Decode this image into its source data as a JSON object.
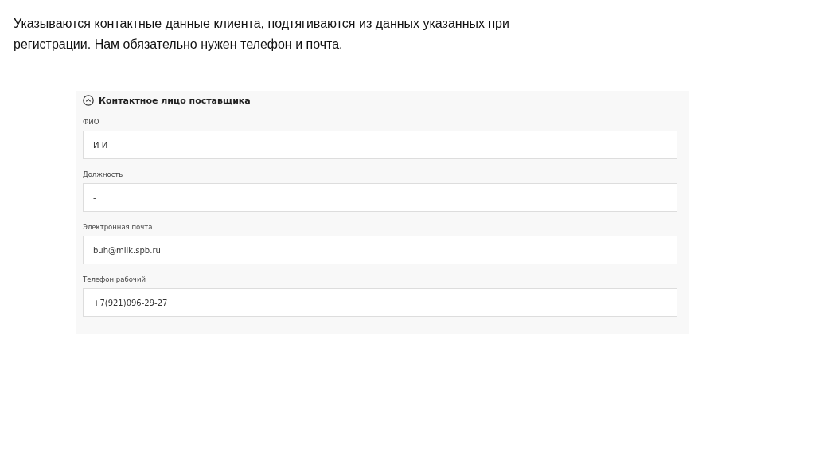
{
  "caption": "Указываются контактные данные клиента, подтягиваются из данных указанных при регистрации. Нам обязательно нужен телефон и почта.",
  "section": {
    "title": "Контактное лицо поставщика",
    "expanded": true,
    "fields": [
      {
        "label": "ФИО",
        "value": "И И"
      },
      {
        "label": "Должность",
        "value": "-"
      },
      {
        "label": "Электронная почта",
        "value": "buh@milk.spb.ru"
      },
      {
        "label": "Телефон рабочий",
        "value": "+7(921)096-29-27"
      }
    ]
  }
}
